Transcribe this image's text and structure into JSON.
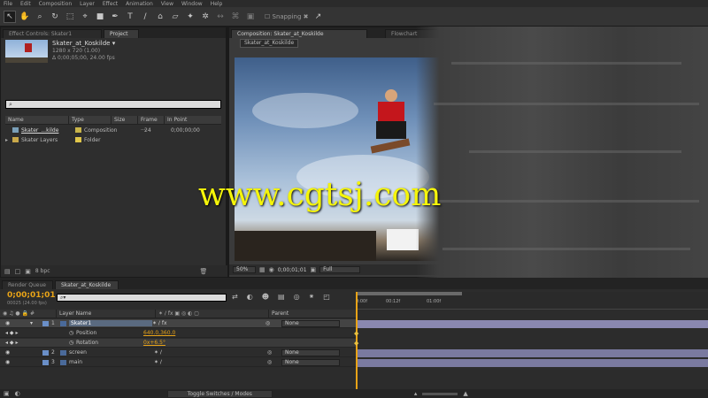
{
  "menu": [
    "File",
    "Edit",
    "Composition",
    "Layer",
    "Effect",
    "Animation",
    "View",
    "Window",
    "Help"
  ],
  "toolbar": {
    "snapping_label": "Snapping",
    "snapping_checked": true
  },
  "project_panel": {
    "tabs": [
      "Effect Controls: Skater1",
      "Project"
    ],
    "comp_name": "Skater_at_Koskilde ▾",
    "comp_size": "1280 x 720 (1.00)",
    "comp_duration": "Δ 0;00;05;00, 24.00 fps",
    "search_placeholder": "⌕",
    "columns": [
      "Name",
      "Type",
      "Size",
      "Frame ...",
      "In Point"
    ],
    "items": [
      {
        "name": "Skater_...kilde",
        "type": "Composition",
        "frame": "24",
        "in_point": "0;00;00;00",
        "kind": "composition"
      },
      {
        "name": "Skater Layers",
        "type": "Folder",
        "frame": "",
        "in_point": "",
        "kind": "folder"
      }
    ],
    "footer_bpc": "8 bpc"
  },
  "composition_panel": {
    "tab": "Composition: Skater_at_Koskilde",
    "subtab": "Skater_at_Koskilde",
    "zoom": "50%",
    "timecode": "0;00;01;01",
    "resolution": "Full",
    "right_tab": "Flowchart"
  },
  "timeline": {
    "tabs": [
      "Render Queue",
      "Skater_at_Koskilde"
    ],
    "current_time": "0;00;01;01",
    "frame_info": "00025 (24.00 fps)",
    "search_placeholder": "⌕▾",
    "columns": {
      "layer_name": "Layer Name",
      "parent": "Parent"
    },
    "ruler": [
      "0:00f",
      "00:12f",
      "01:00f"
    ],
    "layers": [
      {
        "num": "1",
        "name": "Skater1",
        "parent": "None",
        "selected": true
      },
      {
        "num": "",
        "name": "Position",
        "value": "640.0,360.0",
        "property": true
      },
      {
        "num": "",
        "name": "Rotation",
        "value": "0x+6.5°",
        "property": true
      },
      {
        "num": "2",
        "name": "screen",
        "parent": "None"
      },
      {
        "num": "3",
        "name": "main",
        "parent": "None"
      }
    ],
    "toggle_label": "Toggle Switches / Modes"
  },
  "watermark": "www.cgtsj.com",
  "colors": {
    "accent_orange": "#e8a317",
    "watermark_yellow": "#f5f50a",
    "label_blue": "#6a8fc8"
  }
}
